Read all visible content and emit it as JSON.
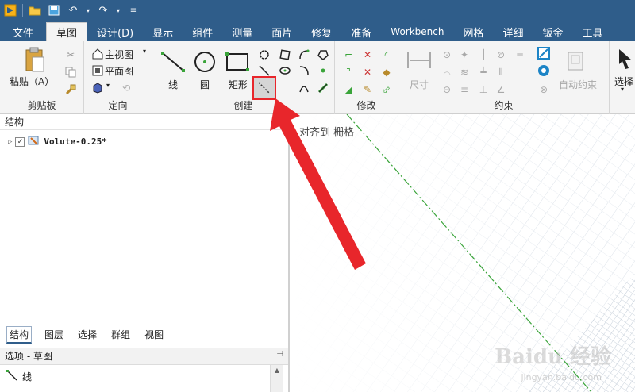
{
  "quick_access": {
    "icons": [
      "app-logo-icon",
      "open-folder-icon",
      "save-icon",
      "undo-icon",
      "redo-icon",
      "customize-icon"
    ]
  },
  "tabs": [
    {
      "label": "文件",
      "active": false
    },
    {
      "label": "草图",
      "active": true
    },
    {
      "label": "设计(D)",
      "active": false
    },
    {
      "label": "显示",
      "active": false
    },
    {
      "label": "组件",
      "active": false
    },
    {
      "label": "测量",
      "active": false
    },
    {
      "label": "面片",
      "active": false
    },
    {
      "label": "修复",
      "active": false
    },
    {
      "label": "准备",
      "active": false
    },
    {
      "label": "Workbench",
      "active": false
    },
    {
      "label": "网格",
      "active": false
    },
    {
      "label": "详细",
      "active": false
    },
    {
      "label": "钣金",
      "active": false
    },
    {
      "label": "工具",
      "active": false
    }
  ],
  "ribbon": {
    "clipboard": {
      "paste_label": "粘贴（A）",
      "group_label": "剪贴板"
    },
    "orient": {
      "main_view_label": "主视图",
      "plan_view_label": "平面图",
      "group_label": "定向"
    },
    "create": {
      "line_label": "线",
      "circle_label": "圆",
      "rect_label": "矩形",
      "group_label": "创建"
    },
    "modify": {
      "group_label": "修改"
    },
    "constraint": {
      "dimension_label": "尺寸",
      "auto_constraint_label": "自动约束",
      "group_label": "约束"
    },
    "select": {
      "select_label": "选择"
    }
  },
  "structure": {
    "title": "结构",
    "tree_item": "Volute-0.25*",
    "tabs": [
      "结构",
      "图层",
      "选择",
      "群组",
      "视图"
    ]
  },
  "options": {
    "title": "选项 - 草图",
    "first_item": "线"
  },
  "canvas": {
    "snap_label": "对齐到 栅格",
    "watermark": "Baidu 经验",
    "watermark_sub": "jingyan.baidu.com"
  },
  "colors": {
    "ribbon_blue": "#2f5d8a",
    "highlight_red": "#e8262b",
    "axis_green": "#3aa43a"
  }
}
